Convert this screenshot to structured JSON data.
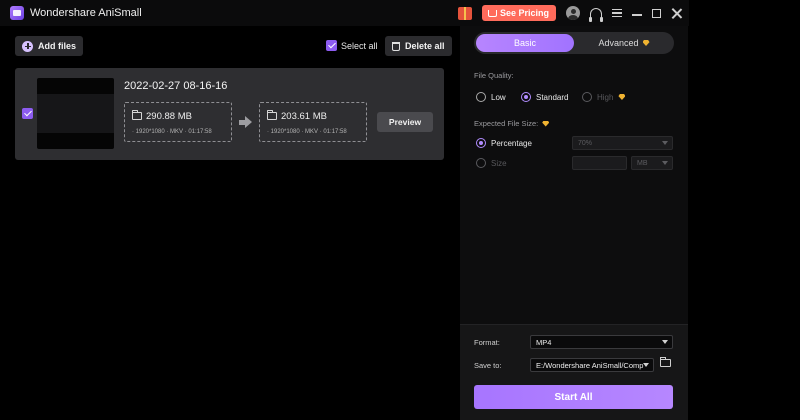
{
  "app": {
    "title": "Wondershare AniSmall"
  },
  "titlebar": {
    "pricing_label": "See Pricing"
  },
  "toolbar": {
    "add_files": "Add files",
    "select_all": "Select all",
    "delete_all": "Delete all"
  },
  "file": {
    "name": "2022-02-27 08-16-16",
    "original": {
      "size": "290.88 MB",
      "meta": "· 1920*1080  · MKV  · 01:17:58"
    },
    "output": {
      "size": "203.61 MB",
      "meta": "· 1920*1080  · MKV  · 01:17:58"
    },
    "preview_label": "Preview"
  },
  "panel": {
    "tabs": [
      {
        "label": "Basic"
      },
      {
        "label": "Advanced"
      }
    ],
    "quality_label": "File Quality:",
    "quality_options": [
      {
        "label": "Low"
      },
      {
        "label": "Standard"
      },
      {
        "label": "High"
      }
    ],
    "expected_label": "Expected File Size:",
    "percentage_label": "Percentage",
    "percentage_value": "70%",
    "size_label": "Size",
    "unit_value": "MB"
  },
  "output": {
    "format_label": "Format:",
    "format_value": "MP4",
    "save_label": "Save to:",
    "save_path": "E:/Wondershare AniSmall/Comp",
    "start_label": "Start All"
  },
  "colors": {
    "accent": "#a775ff",
    "pricing": "#ff6b5b",
    "gem": "#f0b331"
  }
}
